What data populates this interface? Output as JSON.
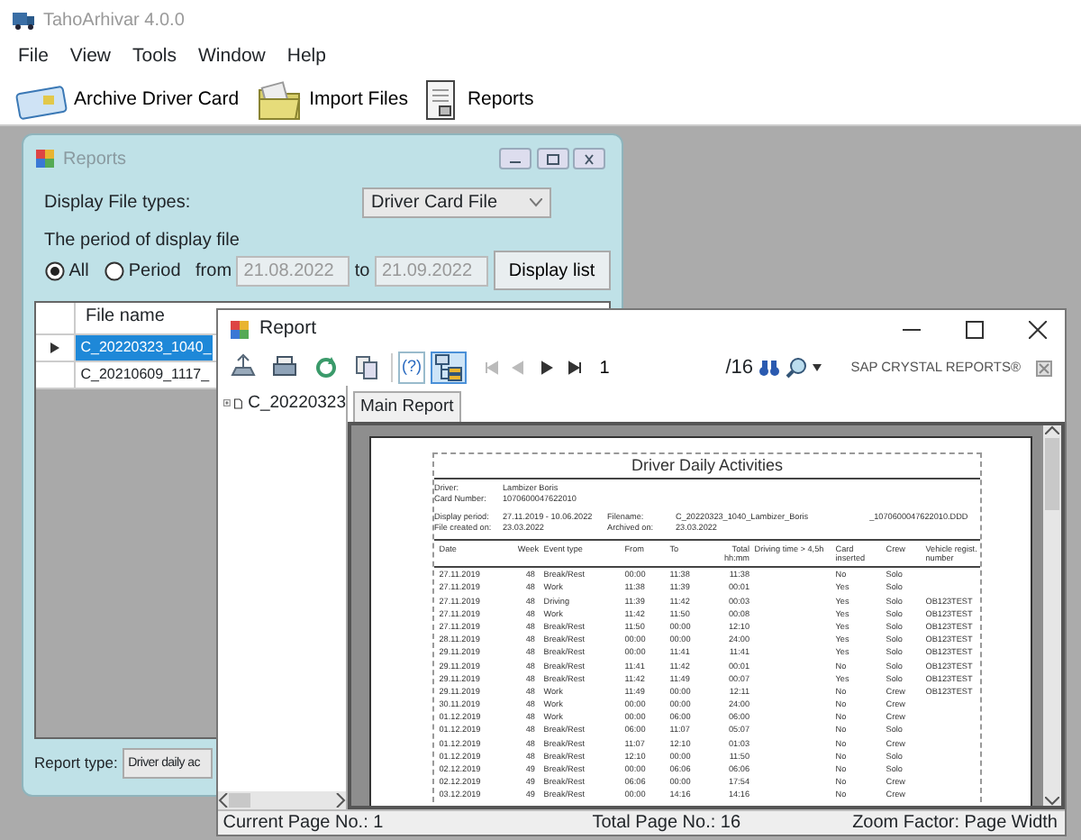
{
  "app": {
    "title": "TahoArhivar 4.0.0"
  },
  "menu": [
    "File",
    "View",
    "Tools",
    "Window",
    "Help"
  ],
  "toolbar": [
    {
      "kind": "card",
      "label": "Archive Driver Card"
    },
    {
      "kind": "folder",
      "label": "Import Files"
    },
    {
      "kind": "document",
      "label": "Reports"
    }
  ],
  "reports_dialog": {
    "title": "Reports",
    "file_type_label": "Display File types:",
    "file_type_value": "Driver Card File",
    "period_label": "The period of display file",
    "radios": [
      {
        "label": "All",
        "selected": true
      },
      {
        "label": "Period",
        "selected": false
      }
    ],
    "from_label": "from",
    "from_date": "21.08.2022",
    "to_label": "to",
    "to_date": "21.09.2022",
    "display_button": "Display list",
    "file_column": "File name",
    "files": [
      {
        "name": "C_20220323_1040_",
        "selected": true
      },
      {
        "name": "C_20210609_1117_",
        "selected": false
      }
    ],
    "report_type_label": "Report type:",
    "report_type_value": "Driver daily ac"
  },
  "report_window": {
    "title": "Report",
    "tools": [
      {
        "kind": "export"
      },
      {
        "kind": "print"
      },
      {
        "kind": "refresh"
      },
      {
        "kind": "copy"
      },
      {
        "kind": "help",
        "label": "(?)",
        "pressed": false
      },
      {
        "kind": "tree",
        "pressed": true
      }
    ],
    "nav": [
      {
        "kind": "first",
        "disabled": true
      },
      {
        "kind": "prev",
        "disabled": true
      },
      {
        "kind": "next",
        "disabled": false
      },
      {
        "kind": "last",
        "disabled": false
      }
    ],
    "page_field": "1",
    "page_total": "/16",
    "brand": "SAP CRYSTAL REPORTS®",
    "tree_item": "C_20220323",
    "tab": "Main Report",
    "report": {
      "title": "Driver Daily Activities",
      "info_rows": [
        [
          {
            "label": "Driver:",
            "value": "Lambizer Boris"
          }
        ],
        [
          {
            "label": "Card Number:",
            "value": "1070600047622010"
          }
        ],
        [
          {
            "label": "Display period:",
            "value": "27.11.2019 - 10.06.2022"
          },
          {
            "label": "Filename:",
            "value": "C_20220323_1040_Lambizer_Boris"
          },
          {
            "value": "_1070600047622010.DDD"
          }
        ],
        [
          {
            "label": "File created on:",
            "value": "23.03.2022"
          },
          {
            "label": "Archived on:",
            "value": "23.03.2022"
          }
        ]
      ],
      "columns": [
        "Date",
        "Week",
        "Event type",
        "From",
        "To",
        "Total hh:mm",
        "Driving time > 4,5h",
        "Card inserted",
        "Crew",
        "Vehicle regist. number"
      ],
      "rows": [
        [
          "27.11.2019",
          "48",
          "Break/Rest",
          "00:00",
          "11:38",
          "11:38",
          "",
          "No",
          "Solo",
          ""
        ],
        [
          "27.11.2019",
          "48",
          "Work",
          "11:38",
          "11:39",
          "00:01",
          "",
          "Yes",
          "Solo",
          ""
        ],
        [
          "27.11.2019",
          "48",
          "Driving",
          "11:39",
          "11:42",
          "00:03",
          "",
          "Yes",
          "Solo",
          "OB123TEST"
        ],
        [
          "27.11.2019",
          "48",
          "Work",
          "11:42",
          "11:50",
          "00:08",
          "",
          "Yes",
          "Solo",
          "OB123TEST"
        ],
        [
          "27.11.2019",
          "48",
          "Break/Rest",
          "11:50",
          "00:00",
          "12:10",
          "",
          "Yes",
          "Solo",
          "OB123TEST"
        ],
        [
          "28.11.2019",
          "48",
          "Break/Rest",
          "00:00",
          "00:00",
          "24:00",
          "",
          "Yes",
          "Solo",
          "OB123TEST"
        ],
        [
          "29.11.2019",
          "48",
          "Break/Rest",
          "00:00",
          "11:41",
          "11:41",
          "",
          "Yes",
          "Solo",
          "OB123TEST"
        ],
        [
          "29.11.2019",
          "48",
          "Break/Rest",
          "11:41",
          "11:42",
          "00:01",
          "",
          "No",
          "Solo",
          "OB123TEST"
        ],
        [
          "29.11.2019",
          "48",
          "Break/Rest",
          "11:42",
          "11:49",
          "00:07",
          "",
          "Yes",
          "Solo",
          "OB123TEST"
        ],
        [
          "29.11.2019",
          "48",
          "Work",
          "11:49",
          "00:00",
          "12:11",
          "",
          "No",
          "Crew",
          "OB123TEST"
        ],
        [
          "30.11.2019",
          "48",
          "Work",
          "00:00",
          "00:00",
          "24:00",
          "",
          "No",
          "Crew",
          ""
        ],
        [
          "01.12.2019",
          "48",
          "Work",
          "00:00",
          "06:00",
          "06:00",
          "",
          "No",
          "Crew",
          ""
        ],
        [
          "01.12.2019",
          "48",
          "Break/Rest",
          "06:00",
          "11:07",
          "05:07",
          "",
          "No",
          "Solo",
          ""
        ],
        [
          "01.12.2019",
          "48",
          "Break/Rest",
          "11:07",
          "12:10",
          "01:03",
          "",
          "No",
          "Crew",
          ""
        ],
        [
          "01.12.2019",
          "48",
          "Break/Rest",
          "12:10",
          "00:00",
          "11:50",
          "",
          "No",
          "Solo",
          ""
        ],
        [
          "02.12.2019",
          "49",
          "Break/Rest",
          "00:00",
          "06:06",
          "06:06",
          "",
          "No",
          "Solo",
          ""
        ],
        [
          "02.12.2019",
          "49",
          "Break/Rest",
          "06:06",
          "00:00",
          "17:54",
          "",
          "No",
          "Crew",
          ""
        ],
        [
          "03.12.2019",
          "49",
          "Break/Rest",
          "00:00",
          "14:16",
          "14:16",
          "",
          "No",
          "Crew",
          ""
        ]
      ]
    },
    "status": [
      "Current Page No.: 1",
      "Total Page No.: 16",
      "Zoom Factor: Page Width"
    ]
  }
}
